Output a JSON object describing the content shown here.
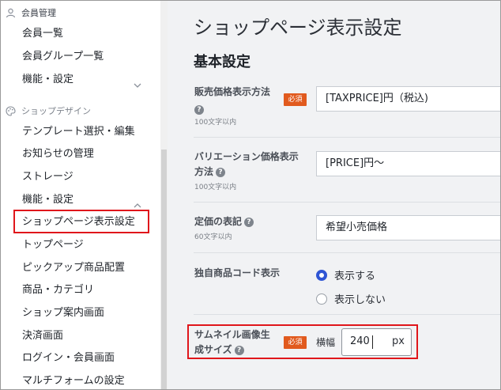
{
  "sidebar": {
    "section_member": "会員管理",
    "member_items": [
      "会員一覧",
      "会員グループ一覧",
      "機能・設定"
    ],
    "section_design": "ショップデザイン",
    "design_items": [
      "テンプレート選択・編集",
      "お知らせの管理",
      "ストレージ",
      "機能・設定"
    ],
    "active_item": "ショップページ表示設定",
    "design_items_after": [
      "トップページ",
      "ピックアップ商品配置",
      "商品・カテゴリ",
      "ショップ案内画面",
      "決済画面",
      "ログイン・会員画面",
      "マルチフォームの設定"
    ]
  },
  "main": {
    "title": "ショップページ表示設定",
    "section_title": "基本設定",
    "help_glyph": "?",
    "required_badge": "必須",
    "rows": [
      {
        "label": "販売価格表示方法",
        "sub": "100文字以内",
        "value": "[TAXPRICE]円（税込)"
      },
      {
        "label_line1": "バリエーション価格表示",
        "label_line2": "方法",
        "sub": "100文字以内",
        "value": "[PRICE]円～"
      },
      {
        "label": "定価の表記",
        "sub": "60文字以内",
        "value": "希望小売価格"
      }
    ],
    "product_code": {
      "label": "独自商品コード表示",
      "options": [
        "表示する",
        "表示しない"
      ],
      "selected": "表示する"
    },
    "thumbnail": {
      "label_line1": "サムネイル画像生",
      "label_line2": "成サイズ",
      "width_label": "横幅",
      "value": "240",
      "unit": "px"
    }
  },
  "colors": {
    "accent": "#2f55d4",
    "required": "#e15a1e",
    "highlight": "#e0161b"
  }
}
